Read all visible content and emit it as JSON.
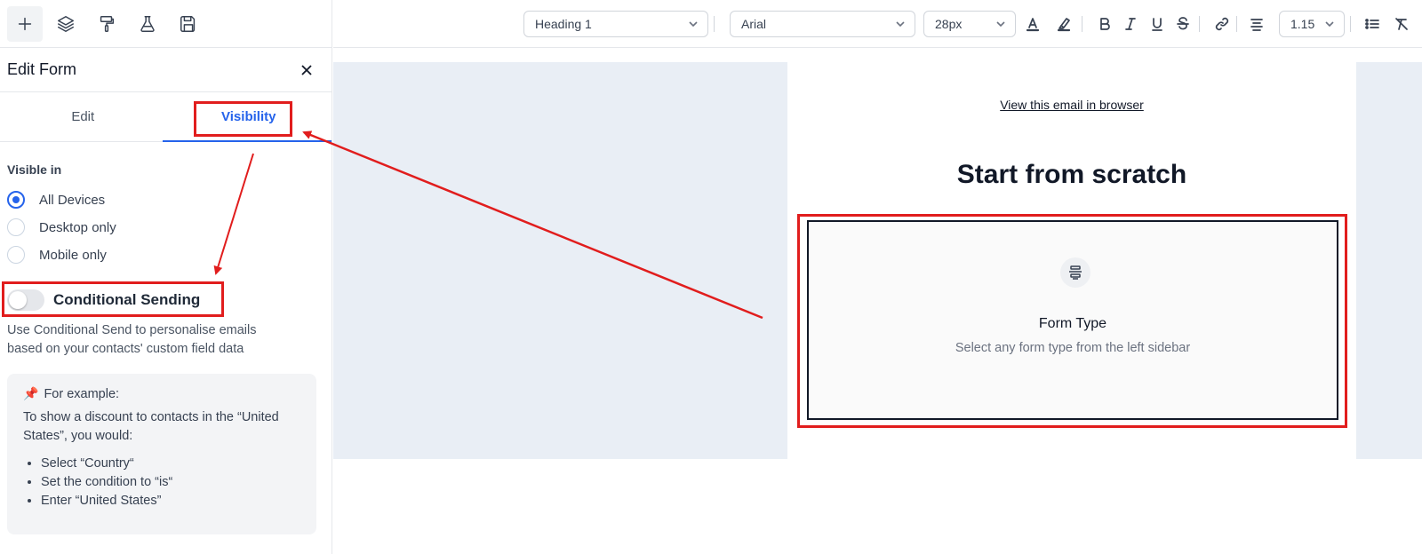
{
  "sidebar_icons": [
    "plus-icon",
    "layers-icon",
    "paint-roller-icon",
    "flask-icon",
    "save-icon"
  ],
  "panel": {
    "title": "Edit Form",
    "tabs": [
      {
        "label": "Edit",
        "active": false
      },
      {
        "label": "Visibility",
        "active": true
      }
    ]
  },
  "visibility": {
    "section_label": "Visible in",
    "options": [
      {
        "label": "All Devices",
        "checked": true
      },
      {
        "label": "Desktop only",
        "checked": false
      },
      {
        "label": "Mobile only",
        "checked": false
      }
    ]
  },
  "conditional": {
    "toggle_label": "Conditional Sending",
    "enabled": false,
    "help_text": "Use Conditional Send to personalise emails based on your contacts' custom field data"
  },
  "example": {
    "title": "For example:",
    "body": "To show a discount to contacts in the “United States”, you would:",
    "steps": [
      "Select “Country“",
      "Set the condition to “is“",
      "Enter “United States”"
    ]
  },
  "toolbar": {
    "block_type": "Heading 1",
    "font_family": "Arial",
    "font_size": "28px",
    "line_height": "1.15"
  },
  "email": {
    "view_link": "View this email in browser",
    "heading": "Start from scratch",
    "form_title": "Form Type",
    "form_subtitle": "Select any form type from the left sidebar"
  },
  "colors": {
    "accent": "#2563eb",
    "annotation": "#e11d1d",
    "canvas": "#e9eef5"
  }
}
